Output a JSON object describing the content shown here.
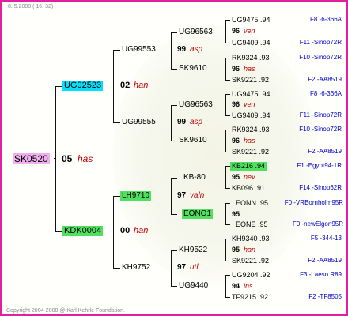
{
  "header_text": "8.  5.2008 ( 16: 32)",
  "footer_text": "Copyright 2004-2008 @ Karl Kehrle Foundation.",
  "colors": {
    "border": "#e020a0",
    "highlight_cyan": "#00e0ff",
    "highlight_green": "#50e060",
    "highlight_pink": "#f0b0f0",
    "link": "#0000cc",
    "red": "#c00000"
  },
  "subject": {
    "id": "SK0520",
    "year": "05",
    "name": "has"
  },
  "g1": [
    {
      "id": "UG02523",
      "year": "02",
      "name": "han"
    },
    {
      "id": "KDK0004",
      "year": "00",
      "name": "han"
    }
  ],
  "g2": [
    {
      "id": "UG99553",
      "year": "99",
      "name": "asp"
    },
    {
      "id": "UG99555",
      "year": "99",
      "name": "asp"
    },
    {
      "id": "LH9710",
      "year": "97",
      "name": "valn"
    },
    {
      "id": "KH9752",
      "year": "97",
      "name": "utl"
    }
  ],
  "g3": [
    "UG96563",
    "SK9610",
    "UG96563",
    "SK9610",
    "KB-80",
    "EONO1",
    "KH9522",
    "UG9440"
  ],
  "g3_years": [
    {
      "year": "96",
      "name": "ven"
    },
    {
      "year": "96",
      "name": "has"
    },
    {
      "year": "96",
      "name": "ven"
    },
    {
      "year": "96",
      "name": "has"
    },
    {
      "year": "95",
      "name": "nev"
    },
    {
      "year": "95",
      "name": ""
    },
    {
      "year": "95",
      "name": "han"
    },
    {
      "year": "94",
      "name": "ins"
    }
  ],
  "g4": [
    {
      "id": "UG9475 .94",
      "link": "F8 -6-366A"
    },
    {
      "id": "UG9409 .94",
      "link": "F11 -Sinop72R"
    },
    {
      "id": "RK9324 .93",
      "link": "F10 -Sinop72R"
    },
    {
      "id": "SK9221 .92",
      "link": "F2 -AA8519"
    },
    {
      "id": "UG9475 .94",
      "link": "F8 -6-366A"
    },
    {
      "id": "UG9409 .94",
      "link": "F11 -Sinop72R"
    },
    {
      "id": "RK9324 .93",
      "link": "F10 -Sinop72R"
    },
    {
      "id": "SK9221 .92",
      "link": "F2 -AA8519"
    },
    {
      "id": "KB216 .94",
      "link": "F1 -Egypt94-1R"
    },
    {
      "id": "KB096 .91",
      "link": "F14 -Sinop62R"
    },
    {
      "id": "EONN .95",
      "link": "F0 -VRBornholm95R"
    },
    {
      "id": "EONE .95",
      "link": "F0 -newElgon95R"
    },
    {
      "id": "KH9340 .93",
      "link": "F5 -344-13"
    },
    {
      "id": "SK9221 .92",
      "link": "F2 -AA8519"
    },
    {
      "id": "UG9204 .92",
      "link": "F3 -Laeso R89"
    },
    {
      "id": "TF9215 .92",
      "link": "F2 -TF8505"
    }
  ]
}
